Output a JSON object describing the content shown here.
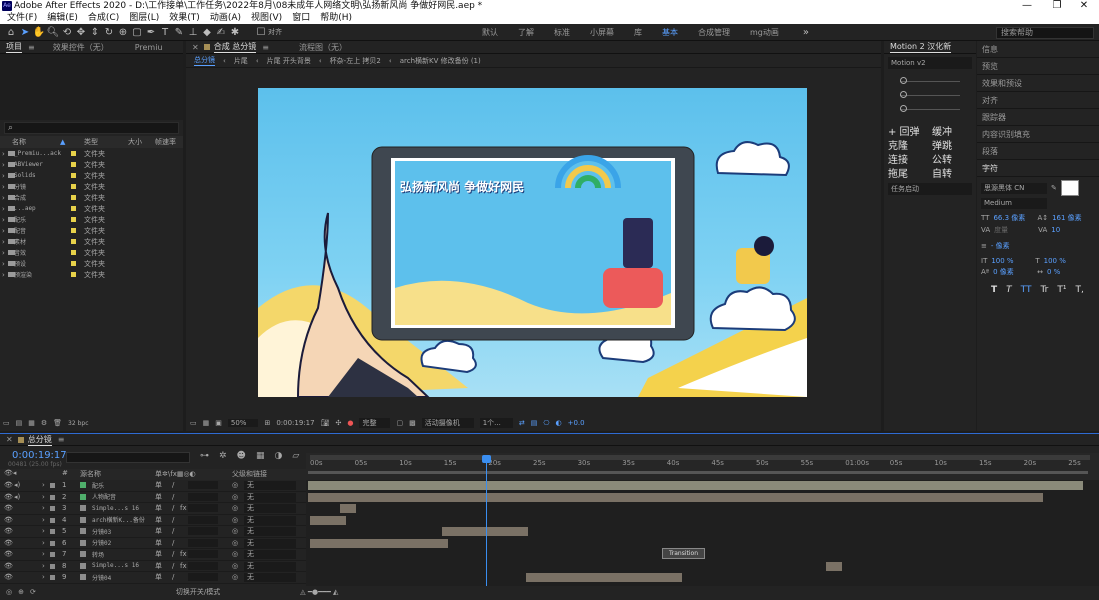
{
  "titlebar": {
    "app_icon": "Ae",
    "title": "Adobe After Effects 2020 - D:\\工作接单\\工作任务\\2022年8月\\08未成年人网络文明\\弘扬新风尚 争做好网民.aep *",
    "minimize": "—",
    "maximize": "❐",
    "close": "✕"
  },
  "menu": [
    "文件(F)",
    "编辑(E)",
    "合成(C)",
    "图层(L)",
    "效果(T)",
    "动画(A)",
    "视图(V)",
    "窗口",
    "帮助(H)"
  ],
  "toolbar": {
    "snap_label": "对齐",
    "workspaces": [
      "默认",
      "了解",
      "标准",
      "小屏幕",
      "库",
      "基本",
      "合成管理",
      "mg动画"
    ],
    "active_workspace": "基本",
    "search_placeholder": "搜索帮助"
  },
  "project": {
    "tab_project": "项目",
    "tab_effects": "效果控件（无）",
    "tab_premiu": "Premiu",
    "cols": {
      "name": "名称",
      "type": "类型",
      "size": "大小",
      "fps": "帧速率"
    },
    "items": [
      {
        "name": "_Premiu...ack",
        "type": "文件夹"
      },
      {
        "name": "ABViewer",
        "type": "文件夹"
      },
      {
        "name": "Solids",
        "type": "文件夹"
      },
      {
        "name": "分镜",
        "type": "文件夹"
      },
      {
        "name": "合成",
        "type": "文件夹"
      },
      {
        "name": "...aep",
        "type": "文件夹"
      },
      {
        "name": "配乐",
        "type": "文件夹"
      },
      {
        "name": "配音",
        "type": "文件夹"
      },
      {
        "name": "素材",
        "type": "文件夹"
      },
      {
        "name": "音效",
        "type": "文件夹"
      },
      {
        "name": "预设",
        "type": "文件夹"
      },
      {
        "name": "预渲染",
        "type": "文件夹"
      }
    ],
    "bpc": "32 bpc"
  },
  "comp": {
    "tab_comp": "合成 总分镜",
    "tab_flow": "流程图（无）",
    "breadcrumbs": [
      "总分镜",
      "片尾",
      "片尾 开头背景",
      "杯杂-左上 拷贝2",
      "arch横新KV 修改备份 (1)"
    ],
    "poster_title": "弘扬新风尚 争做好网民",
    "zoom": "50%",
    "time": "0:00:19:17",
    "quality": "完整",
    "camera": "活动摄像机",
    "views": "1个...",
    "exposure": "+0.0"
  },
  "motion": {
    "tab": "Motion 2 汉化新",
    "version": "Motion v2",
    "buttons": [
      [
        "+ 回弹",
        "缓冲"
      ],
      [
        "克隆",
        "弹跳"
      ],
      [
        "连接",
        "公转"
      ],
      [
        "拖尾",
        "自转"
      ]
    ],
    "task": "任务启动"
  },
  "right_panels": [
    "信息",
    "预览",
    "效果和预设",
    "对齐",
    "跟踪器",
    "内容识别填充",
    "段落",
    "字符"
  ],
  "char": {
    "font": "思源黑体 CN",
    "weight": "Medium",
    "size": "66.3 像素",
    "leading": "161 像素",
    "kerning": "度量",
    "tracking": "10",
    "stroke": "- 像素",
    "vscale": "100 %",
    "hscale": "100 %",
    "baseline": "0 像素",
    "tsume": "0 %",
    "styles": [
      "T",
      "T",
      "TT",
      "Tr",
      "T¹",
      "T,"
    ]
  },
  "timeline": {
    "tab": "总分镜",
    "timecode": "0:00:19:17",
    "frames": "00481 (25.00 fps)",
    "cols": {
      "num": "#",
      "src": "源名称",
      "parent": "父级和链接"
    },
    "ruler": [
      "00s",
      "05s",
      "10s",
      "15s",
      "20s",
      "25s",
      "30s",
      "35s",
      "40s",
      "45s",
      "50s",
      "55s",
      "01:00s",
      "05s",
      "10s",
      "15s",
      "20s",
      "25s"
    ],
    "layers": [
      {
        "n": "1",
        "name": "配乐",
        "parent": "无",
        "fx": false
      },
      {
        "n": "2",
        "name": "人物配音",
        "parent": "无",
        "fx": false
      },
      {
        "n": "3",
        "name": "Simple...s 16",
        "parent": "无",
        "fx": true
      },
      {
        "n": "4",
        "name": "arch横新K...备份",
        "parent": "无",
        "fx": false
      },
      {
        "n": "5",
        "name": "分镜03",
        "parent": "无",
        "fx": false
      },
      {
        "n": "6",
        "name": "分镜02",
        "parent": "无",
        "fx": false
      },
      {
        "n": "7",
        "name": "转场",
        "parent": "无",
        "fx": true
      },
      {
        "n": "8",
        "name": "Simple...s 16",
        "parent": "无",
        "fx": true
      },
      {
        "n": "9",
        "name": "分镜04",
        "parent": "无",
        "fx": false
      }
    ],
    "transition_label": "Transition",
    "footer": "切换开关/模式"
  }
}
